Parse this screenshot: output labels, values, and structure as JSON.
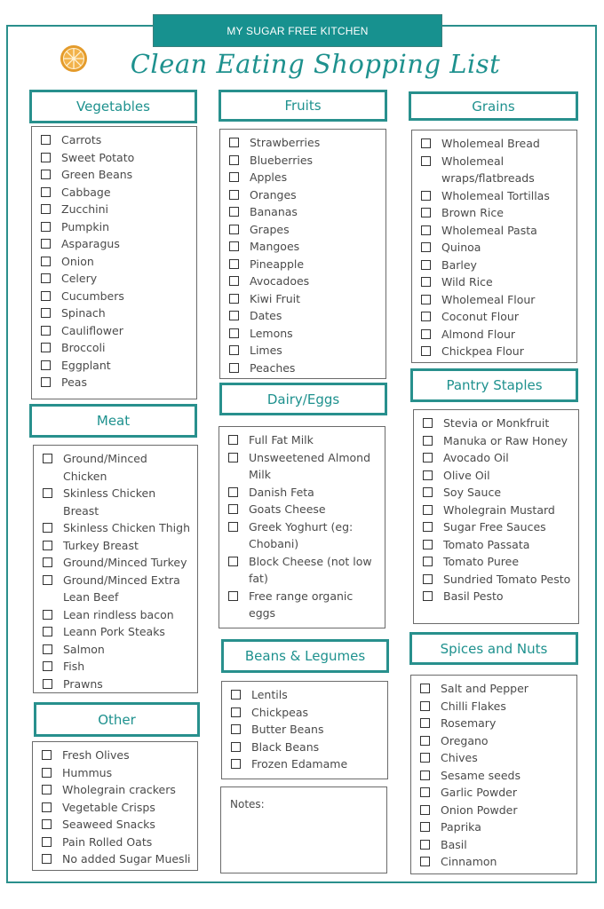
{
  "header": {
    "brand": "MY SUGAR FREE KITCHEN",
    "title": "Clean Eating Shopping List",
    "logo_icon": "orange-slice-icon"
  },
  "colors": {
    "accent": "#1e918e",
    "brand_bar": "#17918f",
    "logo": "#e49b2b",
    "text": "#4a4a4a"
  },
  "sections": {
    "vegetables": {
      "title": "Vegetables",
      "items": [
        "Carrots",
        "Sweet Potato",
        "Green Beans",
        "Cabbage",
        "Zucchini",
        "Pumpkin",
        "Asparagus",
        "Onion",
        "Celery",
        "Cucumbers",
        "Spinach",
        "Cauliflower",
        "Broccoli",
        "Eggplant",
        "Peas"
      ]
    },
    "fruits": {
      "title": "Fruits",
      "items": [
        "Strawberries",
        "Blueberries",
        "Apples",
        "Oranges",
        "Bananas",
        "Grapes",
        "Mangoes",
        "Pineapple",
        "Avocadoes",
        "Kiwi Fruit",
        "Dates",
        "Lemons",
        "Limes",
        "Peaches"
      ]
    },
    "grains": {
      "title": "Grains",
      "items": [
        "Wholemeal Bread",
        "Wholemeal wraps/flatbreads",
        "Wholemeal Tortillas",
        "Brown Rice",
        "Wholemeal Pasta",
        "Quinoa",
        "Barley",
        "Wild Rice",
        "Wholemeal Flour",
        "Coconut Flour",
        "Almond Flour",
        "Chickpea Flour"
      ]
    },
    "meat": {
      "title": "Meat",
      "items": [
        "Ground/Minced Chicken",
        "Skinless Chicken Breast",
        "Skinless Chicken Thigh",
        "Turkey Breast",
        "Ground/Minced Turkey",
        "Ground/Minced Extra Lean Beef",
        "Lean rindless bacon",
        "Leann Pork Steaks",
        "Salmon",
        "Fish",
        "Prawns"
      ]
    },
    "dairy": {
      "title": "Dairy/Eggs",
      "items": [
        "Full Fat Milk",
        "Unsweetened Almond Milk",
        "Danish Feta",
        "Goats Cheese",
        "Greek Yoghurt (eg: Chobani)",
        "Block Cheese (not low fat)",
        "Free range organic eggs"
      ]
    },
    "pantry": {
      "title": "Pantry Staples",
      "items": [
        "Stevia or Monkfruit",
        "Manuka or Raw Honey",
        "Avocado Oil",
        "Olive Oil",
        "Soy Sauce",
        "Wholegrain Mustard",
        "Sugar Free Sauces",
        "Tomato Passata",
        "Tomato Puree",
        "Sundried Tomato Pesto",
        "Basil Pesto"
      ]
    },
    "other": {
      "title": "Other",
      "items": [
        "Fresh Olives",
        "Hummus",
        "Wholegrain crackers",
        "Vegetable Crisps",
        "Seaweed Snacks",
        "Pain Rolled Oats",
        "No added Sugar Muesli"
      ]
    },
    "beans": {
      "title": "Beans & Legumes",
      "items": [
        "Lentils",
        "Chickpeas",
        "Butter Beans",
        "Black Beans",
        "Frozen Edamame"
      ]
    },
    "spices": {
      "title": "Spices and Nuts",
      "items": [
        "Salt and Pepper",
        "Chilli Flakes",
        "Rosemary",
        "Oregano",
        "Chives",
        "Sesame seeds",
        "Garlic Powder",
        "Onion Powder",
        "Paprika",
        "Basil",
        "Cinnamon"
      ]
    }
  },
  "notes": {
    "label": "Notes:"
  }
}
